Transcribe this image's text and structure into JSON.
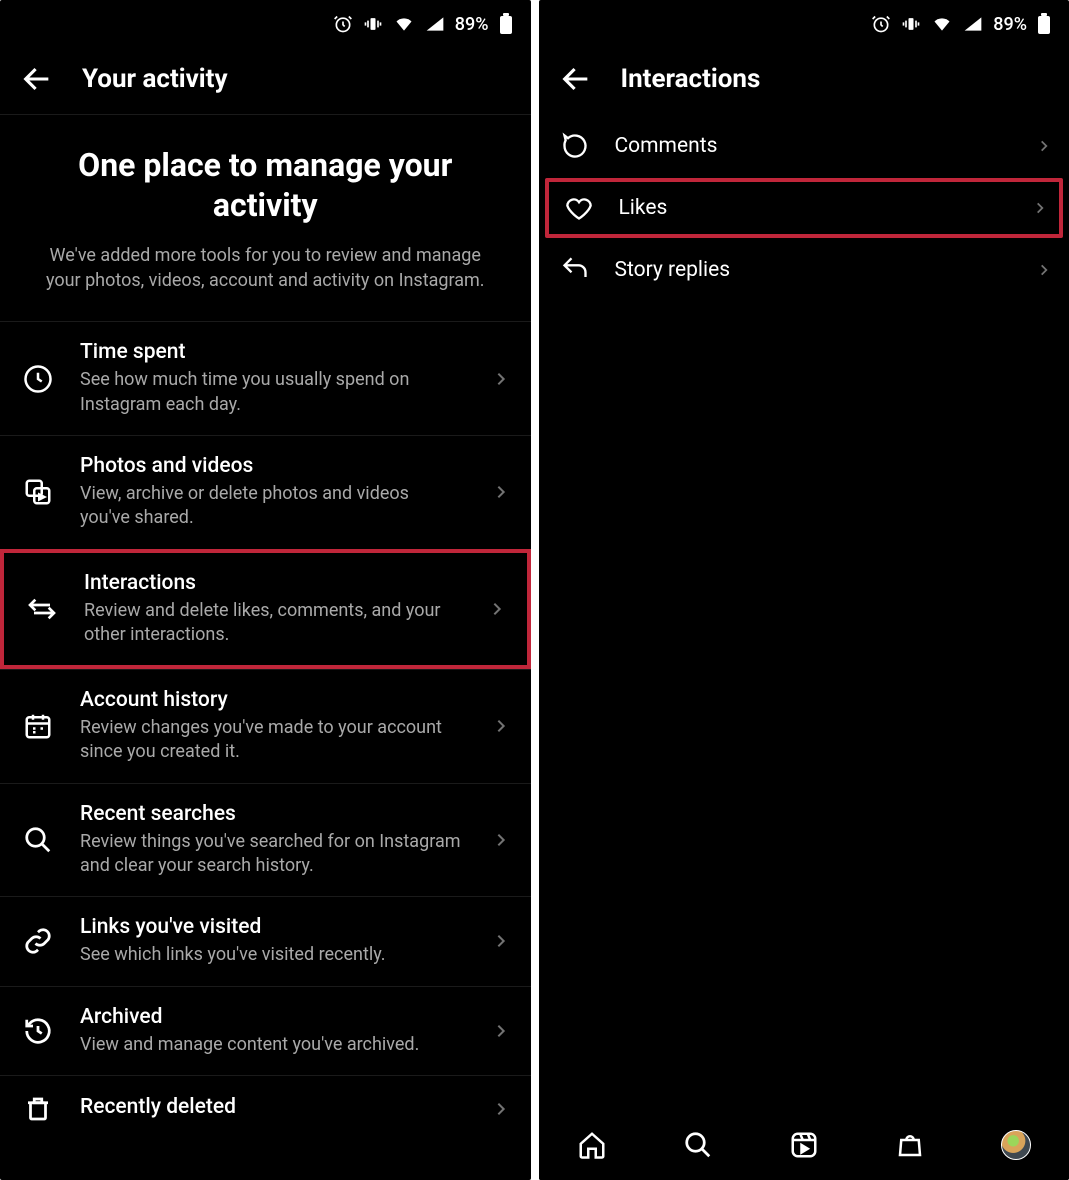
{
  "status": {
    "battery": "89%"
  },
  "left": {
    "appbar_title": "Your activity",
    "intro_heading": "One place to manage your activity",
    "intro_body": "We've added more tools for you to review and manage your photos, videos, account and activity on Instagram.",
    "items": [
      {
        "title": "Time spent",
        "subtitle": "See how much time you usually spend on Instagram each day."
      },
      {
        "title": "Photos and videos",
        "subtitle": "View, archive or delete photos and videos you've shared."
      },
      {
        "title": "Interactions",
        "subtitle": "Review and delete likes, comments, and your other interactions."
      },
      {
        "title": "Account history",
        "subtitle": "Review changes you've made to your account since you created it."
      },
      {
        "title": "Recent searches",
        "subtitle": "Review things you've searched for on Instagram and clear your search history."
      },
      {
        "title": "Links you've visited",
        "subtitle": "See which links you've visited recently."
      },
      {
        "title": "Archived",
        "subtitle": "View and manage content you've archived."
      },
      {
        "title": "Recently deleted",
        "subtitle": ""
      }
    ]
  },
  "right": {
    "appbar_title": "Interactions",
    "items": [
      {
        "label": "Comments"
      },
      {
        "label": "Likes"
      },
      {
        "label": "Story replies"
      }
    ]
  }
}
